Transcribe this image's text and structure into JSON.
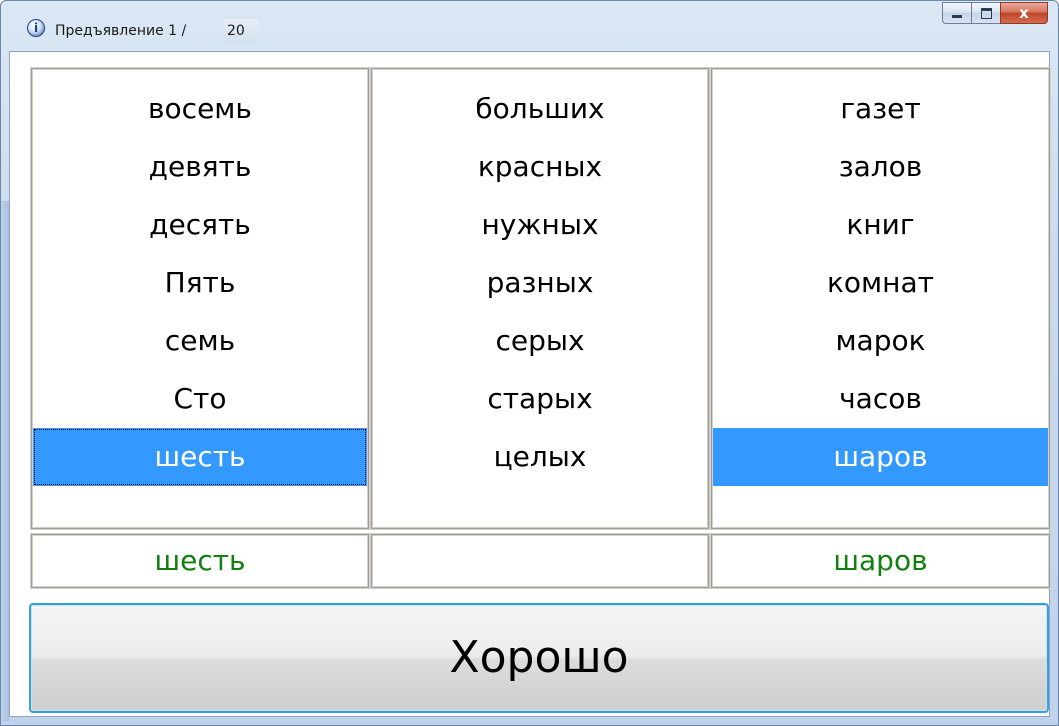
{
  "window": {
    "title": "Предъявление 1 /",
    "count": "20",
    "icon": "info-globe-icon",
    "controls": {
      "minimize": "minimize-icon",
      "maximize": "maximize-icon",
      "close_label": "x"
    }
  },
  "columns": [
    {
      "words": [
        "восемь",
        "девять",
        "десять",
        "Пять",
        "семь",
        "Сто",
        "шесть"
      ],
      "selected_index": 6
    },
    {
      "words": [
        "больших",
        "красных",
        "нужных",
        "разных",
        "серых",
        "старых",
        "целых"
      ],
      "selected_index": null
    },
    {
      "words": [
        "газет",
        "залов",
        "книг",
        "комнат",
        "марок",
        "часов",
        "шаров"
      ],
      "selected_index": 6
    }
  ],
  "answers": [
    "шесть",
    "",
    "шаров"
  ],
  "ok_button": {
    "label": "Хорошо"
  },
  "colors": {
    "selection": "#3399ff",
    "answer_text": "#108010",
    "button_border": "#3c9fd6"
  }
}
